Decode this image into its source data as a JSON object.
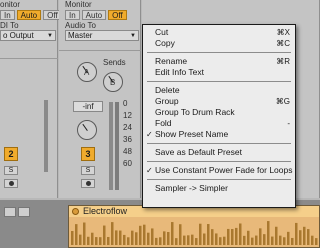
{
  "left_strip": {
    "monitor_label": "onitor",
    "monitor_buttons": [
      {
        "label": "In",
        "active": false
      },
      {
        "label": "Auto",
        "active": true
      },
      {
        "label": "Off",
        "active": false
      }
    ],
    "io_label": "DI To",
    "output": "o Output"
  },
  "mid_strip": {
    "monitor_label": "Monitor",
    "monitor_buttons": [
      {
        "label": "In",
        "active": false
      },
      {
        "label": "Auto",
        "active": false
      },
      {
        "label": "Off",
        "active": true
      }
    ],
    "audio_to_label": "Audio To",
    "output": "Master",
    "sends_label": "Sends",
    "send_a": "A",
    "send_b": "B",
    "volume": "-inf",
    "meter_ticks": [
      "0",
      "12",
      "24",
      "36",
      "48",
      "60"
    ],
    "track_left_number": "2",
    "track_number": "3",
    "solo_label": "S"
  },
  "clip": {
    "name": "Electroflow",
    "color": "#e8b97a"
  },
  "context_menu": {
    "groups": [
      [
        {
          "label": "Cut",
          "shortcut": "⌘X"
        },
        {
          "label": "Copy",
          "shortcut": "⌘C"
        }
      ],
      [
        {
          "label": "Rename",
          "shortcut": "⌘R"
        },
        {
          "label": "Edit Info Text",
          "shortcut": ""
        }
      ],
      [
        {
          "label": "Delete",
          "shortcut": ""
        },
        {
          "label": "Group",
          "shortcut": "⌘G"
        },
        {
          "label": "Group To Drum Rack",
          "shortcut": ""
        },
        {
          "label": "Fold",
          "shortcut": "-"
        },
        {
          "label": "Show Preset Name",
          "shortcut": "",
          "checked": true
        }
      ],
      [
        {
          "label": "Save as Default Preset",
          "shortcut": ""
        }
      ],
      [
        {
          "label": "Use Constant Power Fade for Loops",
          "shortcut": "",
          "checked": true
        }
      ],
      [
        {
          "label": "Sampler -> Simpler",
          "shortcut": ""
        }
      ]
    ],
    "check_glyph": "✓"
  },
  "colors": {
    "accent": "#f0ab2c",
    "menu_bg": "#ececec"
  }
}
